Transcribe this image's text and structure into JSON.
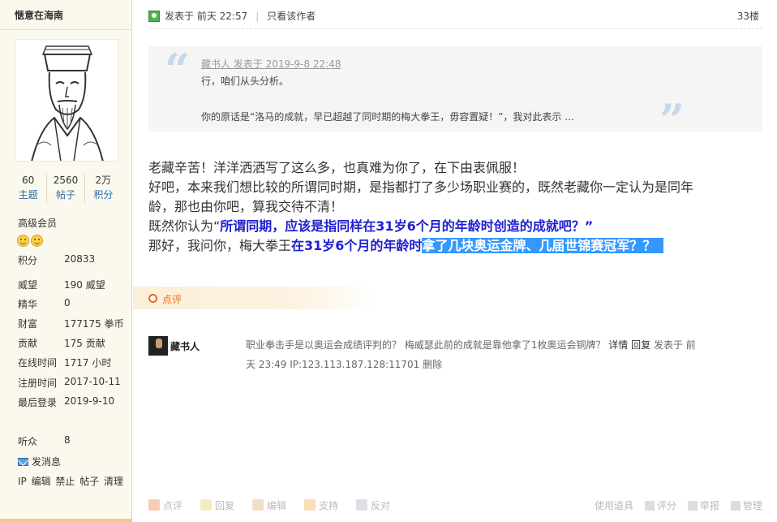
{
  "sidebar": {
    "username": "惬意在海南",
    "stats": [
      {
        "num": "60",
        "label": "主题"
      },
      {
        "num": "2560",
        "label": "帖子"
      },
      {
        "num": "2万",
        "label": "积分"
      }
    ],
    "group": "高级会员",
    "info": [
      {
        "k": "积分",
        "v": "20833"
      },
      {
        "k": "威望",
        "v": "190 威望"
      },
      {
        "k": "精华",
        "v": "0"
      },
      {
        "k": "财富",
        "v": "177175 拳币"
      },
      {
        "k": "贡献",
        "v": "175 贡献"
      },
      {
        "k": "在线时间",
        "v": "1717 小时"
      },
      {
        "k": "注册时间",
        "v": "2017-10-11"
      },
      {
        "k": "最后登录",
        "v": "2019-9-10"
      }
    ],
    "listeners_label": "听众",
    "listeners": "8",
    "send_msg": "发消息",
    "admin_links": "IP 编辑 禁止 帖子 清理"
  },
  "post": {
    "posted_at": "发表于 前天 22:57",
    "author_only": "只看该作者",
    "floor": "33楼",
    "quote": {
      "author_line": "藏书人 发表于 2019-9-8 22:48",
      "line1": "行，咱们从头分析。",
      "line2": "你的原话是“洛马的成就，早已超越了同时期的梅大拳王，毋容置疑！”，我对此表示 ..."
    },
    "para1": "老藏辛苦！洋洋洒洒写了这么多，也真难为你了，在下由衷佩服！",
    "para2a": "好吧，本来我们想比较的所谓同时期，是指都打了多少场职业赛的，既然老藏你一定认为是同年",
    "para2b": "龄，那也由你吧，算我交待不清！",
    "para3_prefix": "既然你认为“",
    "para3_bold": "所谓同期，应该是指同样在31岁6个月的年龄时创造的成就吧？”",
    "para4_prefix": "那好，我问你，梅大拳王",
    "para4_bold": "在31岁6个月的年龄时",
    "para4_highlight": "拿了几块奥运金牌、几届世锦赛冠军？？"
  },
  "rating": {
    "label": "点评"
  },
  "comment": {
    "user": "藏书人",
    "line1_text": "职业拳击手是以奥运会成绩评判的？ 梅威瑟此前的成就是靠他拿了1枚奥运会铜牌？",
    "detail": "详情",
    "reply": "回复",
    "posted": "发表于 前",
    "line2": "天 23:49 IP:123.113.187.128:11701",
    "delete": "删除"
  },
  "actions": {
    "rate": "点评",
    "reply": "回复",
    "edit": "编辑",
    "support": "支持",
    "oppose": "反对",
    "tools": "使用道具",
    "score": "评分",
    "report": "举报",
    "manage": "管理"
  }
}
